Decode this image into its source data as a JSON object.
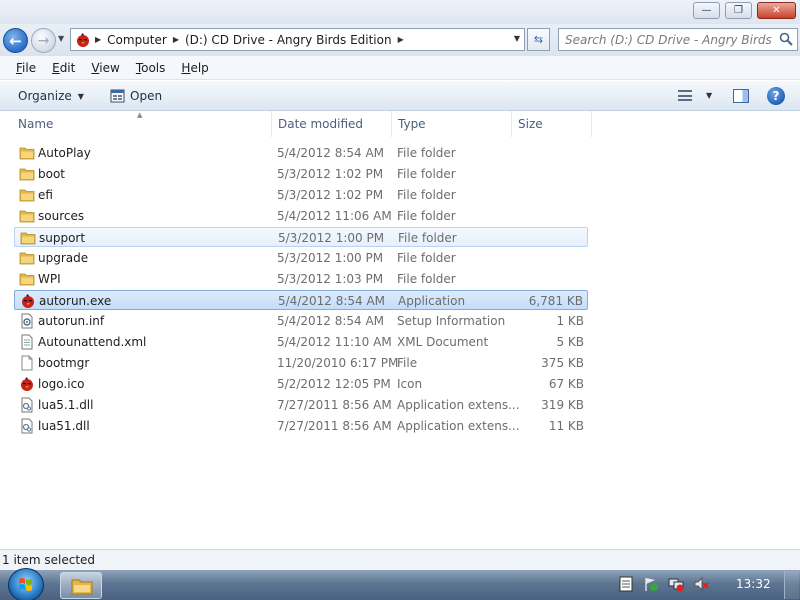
{
  "window": {
    "minimize_glyph": "—",
    "maximize_glyph": "❐",
    "close_glyph": "✕"
  },
  "address": {
    "crumbs": [
      "Computer",
      "(D:) CD Drive - Angry Birds Edition"
    ],
    "search_placeholder": "Search (D:) CD Drive - Angry Birds Edi..."
  },
  "menu": {
    "items": [
      {
        "first": "F",
        "rest": "ile"
      },
      {
        "first": "E",
        "rest": "dit"
      },
      {
        "first": "V",
        "rest": "iew"
      },
      {
        "first": "T",
        "rest": "ools"
      },
      {
        "first": "H",
        "rest": "elp"
      }
    ]
  },
  "toolbar": {
    "organize": "Organize",
    "open": "Open",
    "help": "?"
  },
  "columns": {
    "name": "Name",
    "date": "Date modified",
    "type": "Type",
    "size": "Size"
  },
  "files": [
    {
      "name": "AutoPlay",
      "date": "5/4/2012 8:54 AM",
      "type": "File folder",
      "size": "",
      "icon": "folder-icon"
    },
    {
      "name": "boot",
      "date": "5/3/2012 1:02 PM",
      "type": "File folder",
      "size": "",
      "icon": "folder-icon"
    },
    {
      "name": "efi",
      "date": "5/3/2012 1:02 PM",
      "type": "File folder",
      "size": "",
      "icon": "folder-icon"
    },
    {
      "name": "sources",
      "date": "5/4/2012 11:06 AM",
      "type": "File folder",
      "size": "",
      "icon": "folder-icon"
    },
    {
      "name": "support",
      "date": "5/3/2012 1:00 PM",
      "type": "File folder",
      "size": "",
      "icon": "folder-icon"
    },
    {
      "name": "upgrade",
      "date": "5/3/2012 1:00 PM",
      "type": "File folder",
      "size": "",
      "icon": "folder-icon"
    },
    {
      "name": "WPI",
      "date": "5/3/2012 1:03 PM",
      "type": "File folder",
      "size": "",
      "icon": "folder-icon"
    },
    {
      "name": "autorun.exe",
      "date": "5/4/2012 8:54 AM",
      "type": "Application",
      "size": "6,781 KB",
      "icon": "angry-bird-icon"
    },
    {
      "name": "autorun.inf",
      "date": "5/4/2012 8:54 AM",
      "type": "Setup Information",
      "size": "1 KB",
      "icon": "settings-file-icon"
    },
    {
      "name": "Autounattend.xml",
      "date": "5/4/2012 11:10 AM",
      "type": "XML Document",
      "size": "5 KB",
      "icon": "document-file-icon"
    },
    {
      "name": "bootmgr",
      "date": "11/20/2010 6:17 PM",
      "type": "File",
      "size": "375 KB",
      "icon": "blank-file-icon"
    },
    {
      "name": "logo.ico",
      "date": "5/2/2012 12:05 PM",
      "type": "Icon",
      "size": "67 KB",
      "icon": "angry-bird-icon"
    },
    {
      "name": "lua5.1.dll",
      "date": "7/27/2011 8:56 AM",
      "type": "Application extens...",
      "size": "319 KB",
      "icon": "dll-file-icon"
    },
    {
      "name": "lua51.dll",
      "date": "7/27/2011 8:56 AM",
      "type": "Application extens...",
      "size": "11 KB",
      "icon": "dll-file-icon"
    }
  ],
  "selected_file": "autorun.exe",
  "hovered_file": "support",
  "status": {
    "text": "1 item selected"
  },
  "taskbar": {
    "clock": "13:32"
  },
  "colors": {
    "selection_bg": "#cce4fb",
    "selection_border": "#84acdd",
    "folder": "#e9c25a"
  }
}
